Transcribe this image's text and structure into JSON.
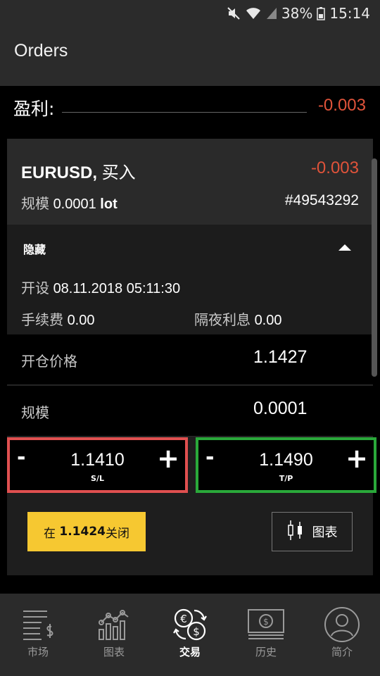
{
  "status_bar": {
    "battery": "38%",
    "time": "15:14",
    "icons": [
      "mute-icon",
      "wifi-icon",
      "signal-icon",
      "battery-icon"
    ]
  },
  "header": {
    "title": "Orders"
  },
  "profit": {
    "label": "盈利:",
    "value": "-0.003"
  },
  "order": {
    "symbol": "EURUSD,",
    "side": "买入",
    "pl": "-0.003",
    "size_label": "规模",
    "size_value": "0.0001",
    "size_unit": "lot",
    "ticket": "#49543292",
    "hide_label": "隐藏",
    "open_label": "开设",
    "open_time": "08.11.2018 05:11:30",
    "fee_label": "手续费",
    "fee_value": "0.00",
    "swap_label": "隔夜利息",
    "swap_value": "0.00",
    "open_price_label": "开仓价格",
    "open_price_value": "1.1427",
    "volume_label": "规模",
    "volume_value": "0.0001",
    "sl": {
      "minus": "-",
      "value": "1.1410",
      "plus": "+",
      "caption": "S/L"
    },
    "tp": {
      "minus": "-",
      "value": "1.1490",
      "plus": "+",
      "caption": "T/P"
    },
    "close_prefix": "在",
    "close_price": "1.1424",
    "close_suffix": "关闭",
    "chart_label": "图表"
  },
  "colors": {
    "negative": "#e0533a",
    "sl_border": "#e05050",
    "tp_border": "#2aa83a",
    "close_button": "#f6c831"
  },
  "nav": {
    "items": [
      {
        "label": "市场",
        "icon": "market-list-icon"
      },
      {
        "label": "图表",
        "icon": "chart-icon"
      },
      {
        "label": "交易",
        "icon": "trade-exchange-icon",
        "active": true
      },
      {
        "label": "历史",
        "icon": "history-banknote-icon"
      },
      {
        "label": "简介",
        "icon": "profile-icon"
      }
    ]
  }
}
